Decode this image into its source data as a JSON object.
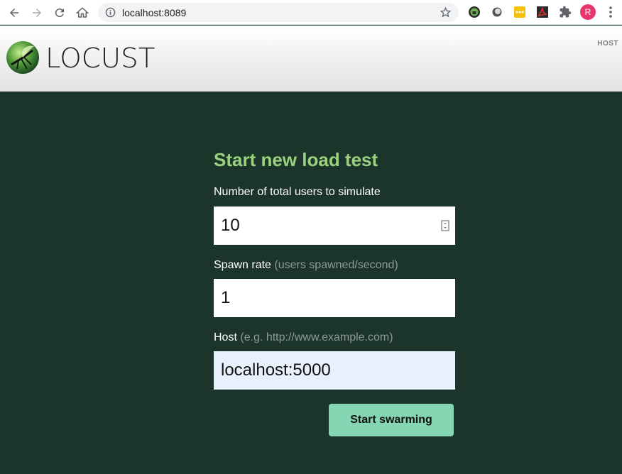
{
  "browser": {
    "url": "localhost:8089",
    "profile_initial": "R"
  },
  "header": {
    "logo_text": "LOCUST",
    "host_label": "HOST"
  },
  "form": {
    "title": "Start new load test",
    "users_label": "Number of total users to simulate",
    "users_value": "10",
    "spawn_label": "Spawn rate",
    "spawn_hint": "(users spawned/second)",
    "spawn_value": "1",
    "host_label": "Host",
    "host_hint": "(e.g. http://www.example.com)",
    "host_value": "localhost:5000",
    "submit_label": "Start swarming"
  },
  "colors": {
    "page_background": "#1b352b",
    "title": "#9ad27f",
    "button": "#86d6b3",
    "autofill": "#e8f0fe"
  },
  "icons": [
    "back-icon",
    "forward-icon",
    "reload-icon",
    "home-icon",
    "info-icon",
    "star-icon",
    "extension-icon",
    "menu-icon"
  ]
}
